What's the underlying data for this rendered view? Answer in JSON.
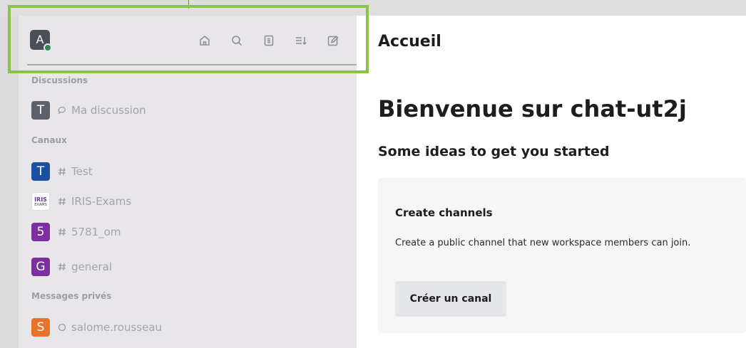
{
  "sidebar": {
    "user_avatar_initial": "A",
    "toolbar": {
      "home": "home-icon",
      "search": "search-icon",
      "directory": "directory-icon",
      "sort": "sort-icon",
      "compose": "compose-icon"
    },
    "sections": {
      "discussions": "Discussions",
      "canaux": "Canaux",
      "messages_prives": "Messages privés"
    },
    "discussions": [
      {
        "initial": "T",
        "name": "Ma discussion",
        "color": "#5c6068"
      }
    ],
    "channels": [
      {
        "initial": "T",
        "name": "Test",
        "color": "#1d4fa0"
      },
      {
        "logo_top": "IRIS",
        "logo_bottom": "EXAMS",
        "name": "IRIS-Exams"
      },
      {
        "initial": "5",
        "name": "5781_om",
        "color": "#7b2fa0"
      },
      {
        "initial": "G",
        "name": "general",
        "color": "#7b2fa0"
      }
    ],
    "direct_messages": [
      {
        "initial": "S",
        "name": "salome.rousseau",
        "color": "#e8742c"
      }
    ]
  },
  "main": {
    "page_title": "Accueil",
    "welcome": "Bienvenue sur chat-ut2j",
    "ideas_heading": "Some ideas to get you started",
    "card": {
      "title": "Create channels",
      "description": "Create a public channel that new workspace members can join.",
      "button": "Créer un canal"
    }
  },
  "colors": {
    "highlight": "#8bc34a",
    "status_online": "#2e8a4c"
  }
}
